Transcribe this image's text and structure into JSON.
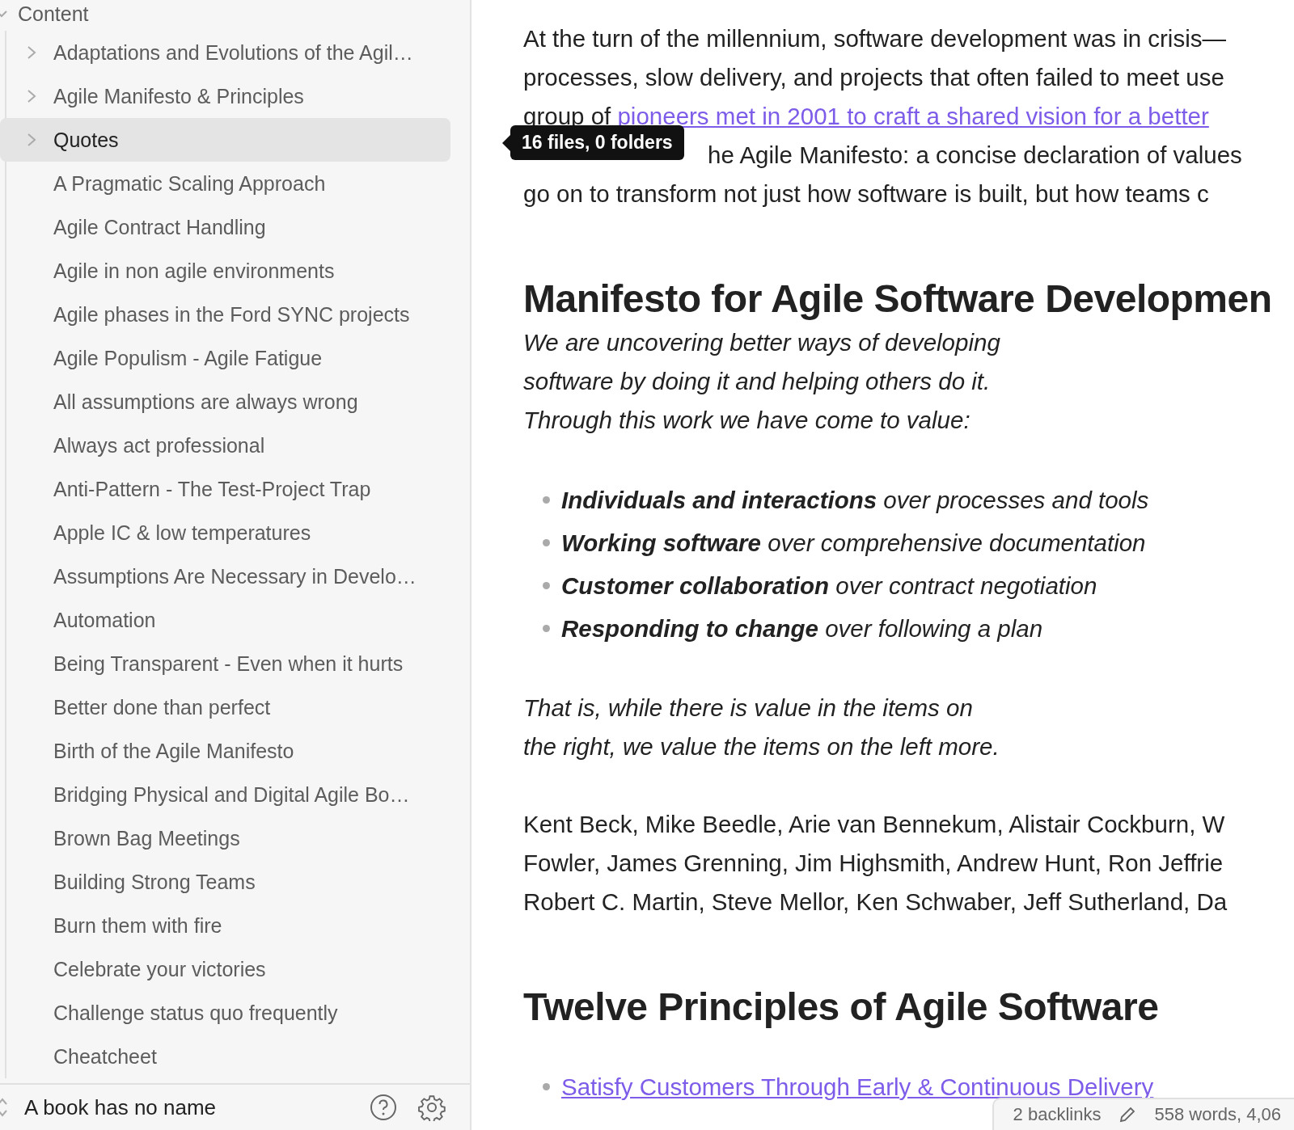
{
  "sidebar": {
    "root": {
      "label": "Content",
      "expanded": true,
      "children": [
        {
          "label": "Adaptations and Evolutions of the Agil…",
          "kind": "folder",
          "selected": false
        },
        {
          "label": "Agile Manifesto & Principles",
          "kind": "folder",
          "selected": false
        },
        {
          "label": "Quotes",
          "kind": "folder",
          "selected": true
        },
        {
          "label": "A Pragmatic Scaling Approach",
          "kind": "file",
          "selected": false
        },
        {
          "label": "Agile Contract Handling",
          "kind": "file",
          "selected": false
        },
        {
          "label": "Agile in non agile environments",
          "kind": "file",
          "selected": false
        },
        {
          "label": "Agile phases in the Ford SYNC projects",
          "kind": "file",
          "selected": false
        },
        {
          "label": "Agile Populism - Agile Fatigue",
          "kind": "file",
          "selected": false
        },
        {
          "label": "All assumptions are always wrong",
          "kind": "file",
          "selected": false
        },
        {
          "label": "Always act professional",
          "kind": "file",
          "selected": false
        },
        {
          "label": "Anti-Pattern - The Test-Project Trap",
          "kind": "file",
          "selected": false
        },
        {
          "label": "Apple IC & low temperatures",
          "kind": "file",
          "selected": false
        },
        {
          "label": "Assumptions Are Necessary in Develo…",
          "kind": "file",
          "selected": false
        },
        {
          "label": "Automation",
          "kind": "file",
          "selected": false
        },
        {
          "label": "Being Transparent - Even when it hurts",
          "kind": "file",
          "selected": false
        },
        {
          "label": "Better done than perfect",
          "kind": "file",
          "selected": false
        },
        {
          "label": "Birth of the Agile Manifesto",
          "kind": "file",
          "selected": false
        },
        {
          "label": "Bridging Physical and Digital Agile Bo…",
          "kind": "file",
          "selected": false
        },
        {
          "label": "Brown Bag Meetings",
          "kind": "file",
          "selected": false
        },
        {
          "label": "Building Strong Teams",
          "kind": "file",
          "selected": false
        },
        {
          "label": "Burn them with fire",
          "kind": "file",
          "selected": false
        },
        {
          "label": "Celebrate your victories",
          "kind": "file",
          "selected": false
        },
        {
          "label": "Challenge status quo frequently",
          "kind": "file",
          "selected": false
        },
        {
          "label": "Cheatcheet",
          "kind": "file",
          "selected": false
        }
      ]
    },
    "vault_name": "A book has no name"
  },
  "tooltip": {
    "text": "16 files, 0 folders"
  },
  "document": [
    {
      "kind": "paragraph",
      "lines": [
        {
          "text": "At the turn of the millennium, software development was in crisis—"
        },
        {
          "text": "processes, slow delivery, and projects that often failed to meet use"
        },
        {
          "text": "group of ",
          "link": "pioneers met in 2001 to craft a shared vision for a better"
        },
        {
          "text": "he Agile Manifesto: a concise declaration of values"
        },
        {
          "text": "go on to transform not just how software is built, but how teams c"
        }
      ]
    },
    {
      "kind": "heading",
      "text": "Manifesto for Agile Software Developmen"
    },
    {
      "kind": "italic",
      "lines": [
        "We are uncovering better ways of developing",
        "software by doing it and helping others do it.",
        "Through this work we have come to value:"
      ]
    },
    {
      "kind": "bullets",
      "items": [
        {
          "bold": "Individuals and interactions",
          "rest": " over processes and tools"
        },
        {
          "bold": "Working software",
          "rest": " over comprehensive documentation"
        },
        {
          "bold": "Customer collaboration",
          "rest": " over contract negotiation"
        },
        {
          "bold": "Responding to change",
          "rest": " over following a plan"
        }
      ]
    },
    {
      "kind": "italic",
      "lines": [
        "That is, while there is value in the items on",
        "the right, we value the items on the left more."
      ]
    },
    {
      "kind": "paragraph",
      "lines": [
        {
          "text": "Kent Beck, Mike Beedle, Arie van Bennekum, Alistair Cockburn, W"
        },
        {
          "text": "Fowler, James Grenning, Jim Highsmith, Andrew Hunt, Ron Jeffrie"
        },
        {
          "text": "Robert C. Martin, Steve Mellor, Ken Schwaber, Jeff Sutherland, Da"
        }
      ]
    },
    {
      "kind": "heading",
      "text": "Twelve Principles of Agile Software"
    },
    {
      "kind": "links",
      "items": [
        "Satisfy Customers Through Early & Continuous Delivery"
      ]
    }
  ],
  "status_bar": {
    "backlinks": "2 backlinks",
    "counts": "558 words, 4,06"
  }
}
